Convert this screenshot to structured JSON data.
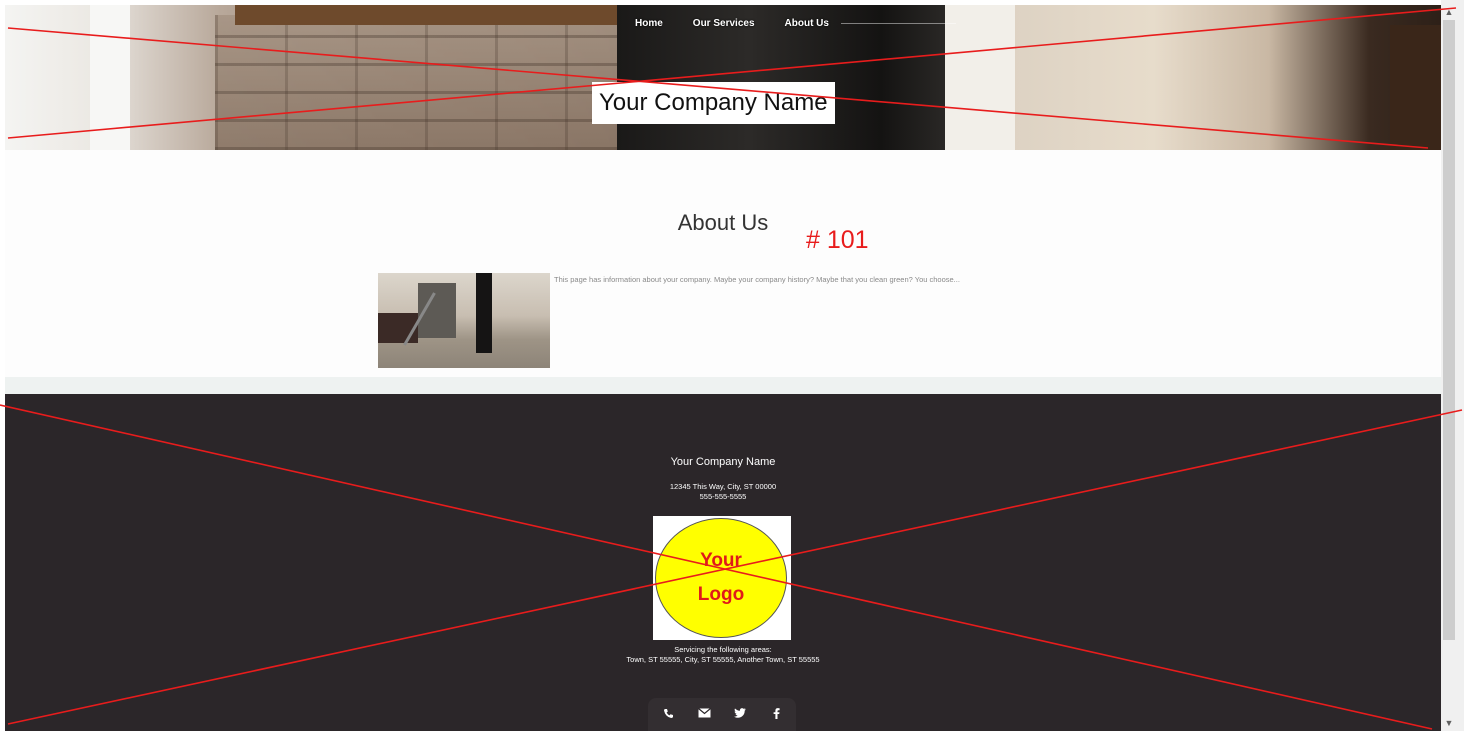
{
  "nav": {
    "items": [
      "Home",
      "Our Services",
      "About Us"
    ]
  },
  "hero": {
    "title": "Your Company Name"
  },
  "about": {
    "heading": "About Us",
    "marker": "# 101",
    "text": "This page has information about your company. Maybe your company history? Maybe that you clean green? You choose..."
  },
  "footer": {
    "company": "Your Company Name",
    "address": "12345 This Way, City, ST 00000",
    "phone": "555-555-5555",
    "logo_line1": "Your",
    "logo_line2": "Logo",
    "service_heading": "Servicing the following areas:",
    "service_areas": "Town, ST 55555, City, ST 55555, Another Town, ST 55555",
    "social_icons": [
      "phone-icon",
      "envelope-icon",
      "twitter-icon",
      "facebook-icon"
    ]
  },
  "colors": {
    "overlay_lines": "#e81c1c",
    "footer_bg": "#2b2629",
    "logo_fill": "#ffff00",
    "logo_text": "#e01a1a"
  }
}
